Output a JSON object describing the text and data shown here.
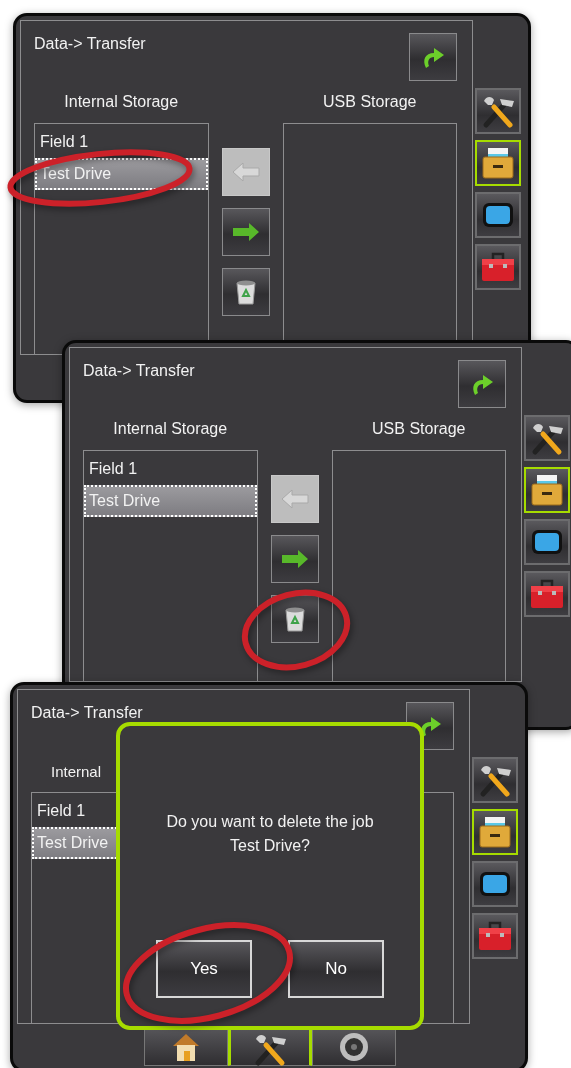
{
  "screens": [
    {
      "title": "Data-> Transfer",
      "left_heading": "Internal Storage",
      "right_heading": "USB Storage",
      "internal_items": [
        {
          "label": "Field 1",
          "selected": false
        },
        {
          "label": "Test Drive",
          "selected": true
        }
      ],
      "transfer_buttons": [
        {
          "kind": "left",
          "disabled": true
        },
        {
          "kind": "right",
          "disabled": false
        },
        {
          "kind": "delete",
          "disabled": false
        }
      ],
      "side_tabs": [
        {
          "kind": "tools",
          "selected": false
        },
        {
          "kind": "storage",
          "selected": true
        },
        {
          "kind": "display",
          "selected": false
        },
        {
          "kind": "toolbox",
          "selected": false
        }
      ],
      "annotation": {
        "kind": "list-item"
      }
    },
    {
      "title": "Data-> Transfer",
      "left_heading": "Internal Storage",
      "right_heading": "USB Storage",
      "internal_items": [
        {
          "label": "Field 1",
          "selected": false
        },
        {
          "label": "Test Drive",
          "selected": true
        }
      ],
      "transfer_buttons": [
        {
          "kind": "left",
          "disabled": true
        },
        {
          "kind": "right",
          "disabled": false
        },
        {
          "kind": "delete",
          "disabled": false
        }
      ],
      "side_tabs": [
        {
          "kind": "tools",
          "selected": false
        },
        {
          "kind": "storage",
          "selected": true
        },
        {
          "kind": "display",
          "selected": false
        },
        {
          "kind": "toolbox",
          "selected": false
        }
      ],
      "annotation": {
        "kind": "delete-button"
      }
    },
    {
      "title": "Data-> Transfer",
      "left_heading": "Internal",
      "internal_items": [
        {
          "label": "Field 1",
          "selected": false
        },
        {
          "label": "Test Drive",
          "selected": true
        }
      ],
      "side_tabs": [
        {
          "kind": "tools",
          "selected": false
        },
        {
          "kind": "storage",
          "selected": true
        },
        {
          "kind": "display",
          "selected": false
        },
        {
          "kind": "toolbox",
          "selected": false
        }
      ],
      "bottom_tabs": [
        {
          "kind": "home",
          "selected": false
        },
        {
          "kind": "tools",
          "selected": true
        },
        {
          "kind": "camera",
          "selected": false
        }
      ],
      "dialog": {
        "message": "Do you want to delete the job Test Drive?",
        "buttons": [
          "Yes",
          "No"
        ]
      },
      "annotation": {
        "kind": "yes-button"
      }
    }
  ]
}
